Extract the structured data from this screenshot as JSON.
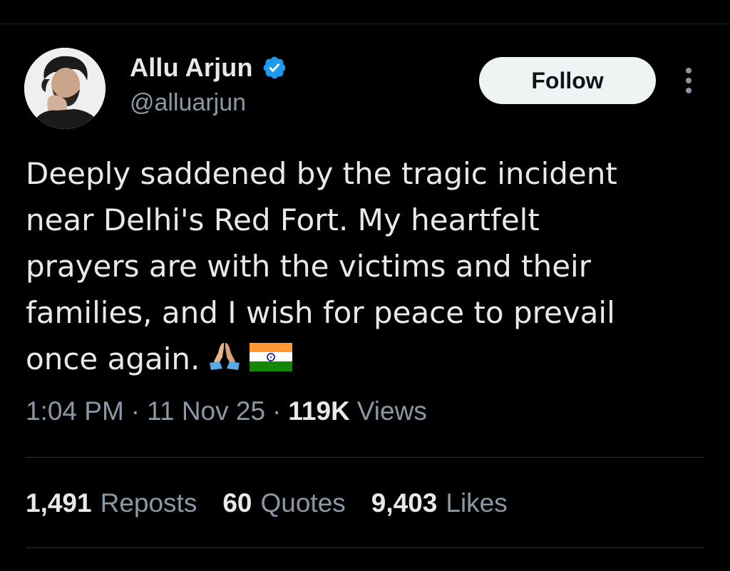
{
  "author": {
    "display_name": "Allu Arjun",
    "handle": "@alluarjun",
    "verified": true,
    "verified_color": "#1d9bf0"
  },
  "actions": {
    "follow_label": "Follow",
    "more_icon": "more-vertical-icon"
  },
  "tweet": {
    "lines": [
      "Deeply saddened by the tragic incident",
      "near Delhi's Red Fort. My heartfelt",
      "prayers are with the victims and their",
      "families, and I wish for peace to prevail",
      "once again."
    ],
    "emojis": [
      "folded-hands-icon",
      "india-flag-icon"
    ]
  },
  "meta": {
    "time": "1:04 PM",
    "separator": "·",
    "date": "11 Nov 25",
    "views_count": "119K",
    "views_label": "Views"
  },
  "stats": [
    {
      "count": "1,491",
      "label": "Reposts"
    },
    {
      "count": "60",
      "label": "Quotes"
    },
    {
      "count": "9,403",
      "label": "Likes"
    }
  ],
  "colors": {
    "background": "#000000",
    "text_primary": "#e7e9ea",
    "text_secondary": "#8b98a5",
    "divider": "#2f3336",
    "follow_bg": "#eff3f4"
  }
}
